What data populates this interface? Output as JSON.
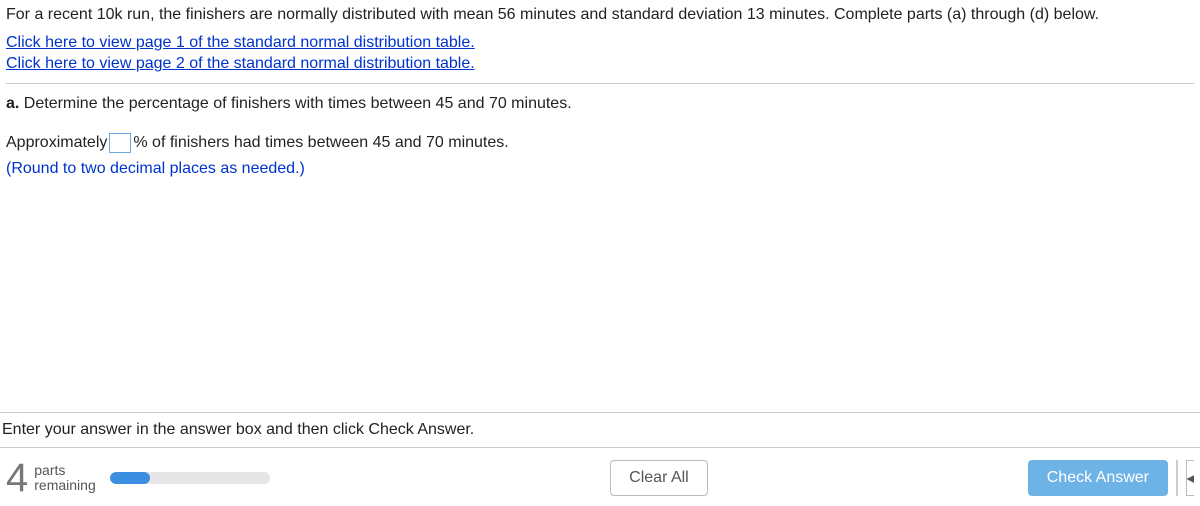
{
  "intro": "For a recent 10k run, the finishers are normally distributed with mean 56 minutes and standard deviation 13 minutes. Complete parts (a) through (d) below.",
  "links": {
    "page1": "Click here to view page 1 of the standard normal distribution table.",
    "page2": "Click here to view page 2 of the standard normal distribution table."
  },
  "partA": {
    "label": "a.",
    "question": " Determine the percentage of finishers with times between 45 and 70 minutes.",
    "prefix": "Approximately ",
    "input_value": "",
    "suffix": "% of finishers had times between 45 and 70 minutes.",
    "hint": "(Round to two decimal places as needed.)"
  },
  "bottomInstruction": "Enter your answer in the answer box and then click Check Answer.",
  "footer": {
    "remaining_number": "4",
    "remaining_label_top": "parts",
    "remaining_label_bottom": "remaining",
    "progress_percent": 25,
    "clear_label": "Clear All",
    "check_label": "Check Answer"
  }
}
